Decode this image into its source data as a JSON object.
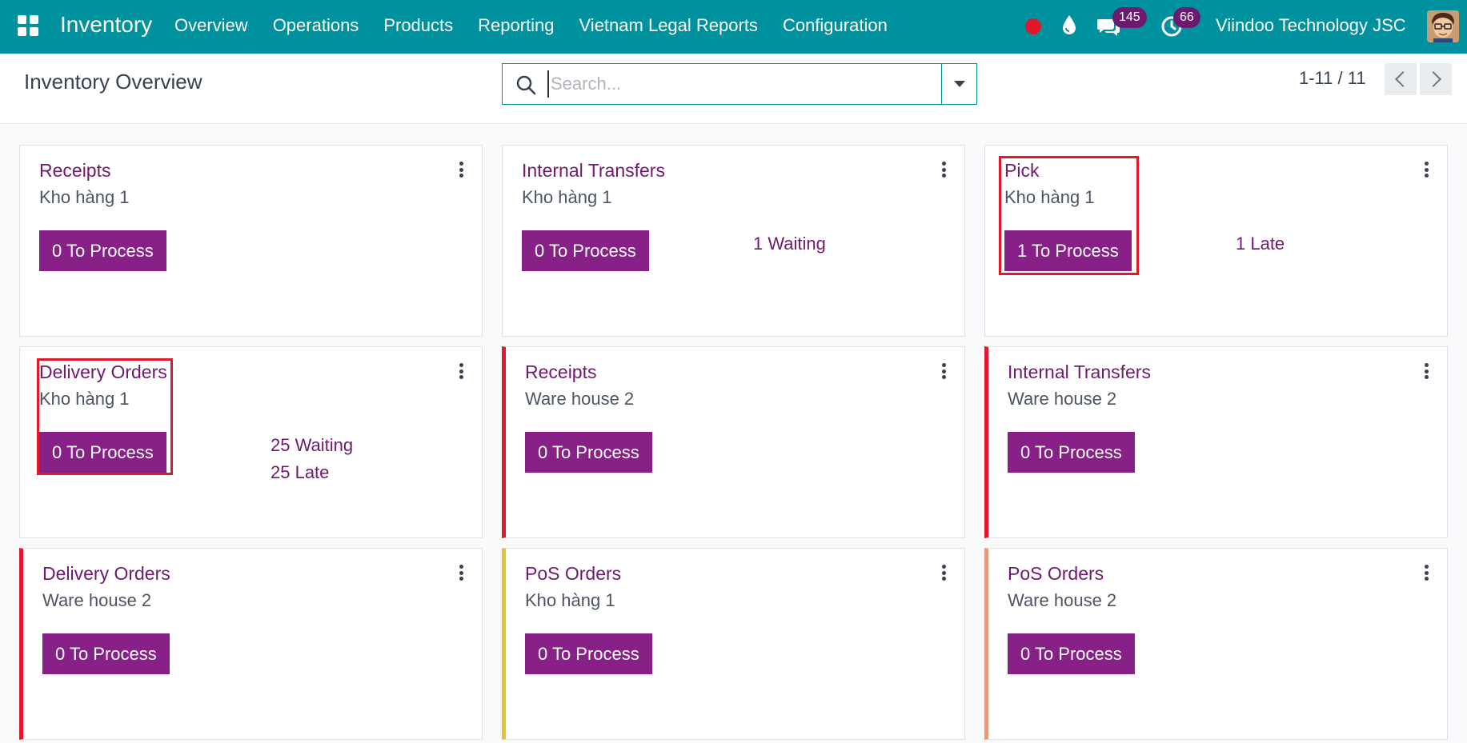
{
  "navbar": {
    "app_name": "Inventory",
    "menu": [
      "Overview",
      "Operations",
      "Products",
      "Reporting",
      "Vietnam Legal Reports",
      "Configuration"
    ],
    "messages_count": "145",
    "activities_count": "66",
    "company": "Viindoo Technology JSC",
    "icons": [
      "apps-icon",
      "record-icon",
      "drop-icon",
      "chat-icon",
      "clock-icon",
      "avatar"
    ]
  },
  "control_panel": {
    "title": "Inventory Overview",
    "search_placeholder": "Search...",
    "pager": "1-11 / 11"
  },
  "colors": {
    "navbar": "#00919e",
    "title": "#71196e",
    "button": "#872187",
    "accent_red": "#e0182d",
    "accent_yellow": "#e9c12e",
    "accent_salmon": "#e59a7b",
    "highlight": "#e0182d"
  },
  "cards": [
    {
      "title": "Receipts",
      "warehouse": "Kho hàng 1",
      "button": "0 To Process",
      "stats": []
    },
    {
      "title": "Internal Transfers",
      "warehouse": "Kho hàng 1",
      "button": "0 To Process",
      "stats": [
        "1 Waiting"
      ]
    },
    {
      "title": "Pick",
      "warehouse": "Kho hàng 1",
      "button": "1 To Process",
      "stats": [
        "1 Late"
      ]
    },
    {
      "title": "Delivery Orders",
      "warehouse": "Kho hàng 1",
      "button": "0 To Process",
      "stats": [
        "25 Waiting",
        "25 Late"
      ]
    },
    {
      "title": "Receipts",
      "warehouse": "Ware house 2",
      "button": "0 To Process",
      "stats": []
    },
    {
      "title": "Internal Transfers",
      "warehouse": "Ware house 2",
      "button": "0 To Process",
      "stats": []
    },
    {
      "title": "Delivery Orders",
      "warehouse": "Ware house 2",
      "button": "0 To Process",
      "stats": []
    },
    {
      "title": "PoS Orders",
      "warehouse": "Kho hàng 1",
      "button": "0 To Process",
      "stats": []
    },
    {
      "title": "PoS Orders",
      "warehouse": "Ware house 2",
      "button": "0 To Process",
      "stats": []
    }
  ]
}
